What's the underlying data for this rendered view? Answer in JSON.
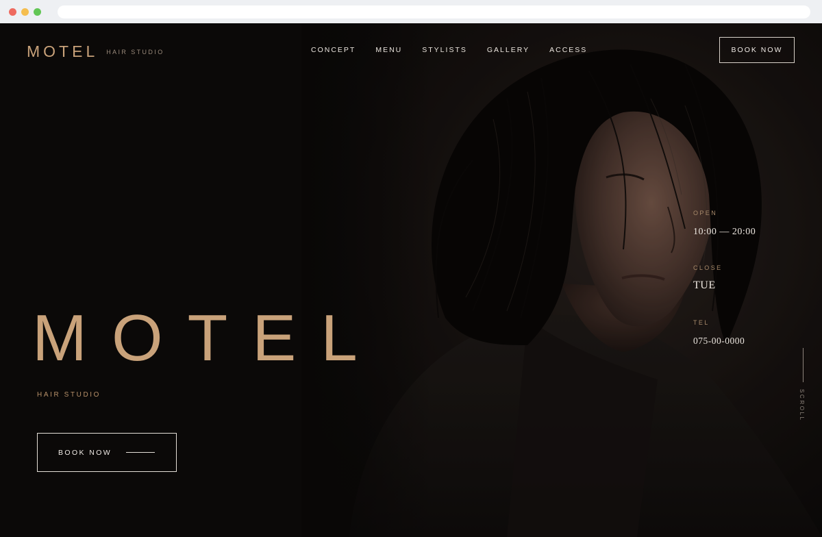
{
  "header": {
    "logo": "MOTEL",
    "logo_sub": "HAIR STUDIO",
    "nav": [
      "CONCEPT",
      "MENU",
      "STYLISTS",
      "GALLERY",
      "ACCESS"
    ],
    "book_button": "BOOK NOW"
  },
  "hero": {
    "title": "MOTEL",
    "subtitle": "HAIR STUDIO",
    "cta": "BOOK NOW",
    "image": "woman-portrait"
  },
  "info": {
    "open_label": "OPEN",
    "open_value": "10:00 — 20:00",
    "close_label": "CLOSE",
    "close_value": "TUE",
    "tel_label": "TEL",
    "tel_value": "075-00-0000"
  },
  "scroll": "SCROLL",
  "colors": {
    "background": "#0b0908",
    "accent_gold": "#c9a27a",
    "text_light": "#ece6df"
  }
}
